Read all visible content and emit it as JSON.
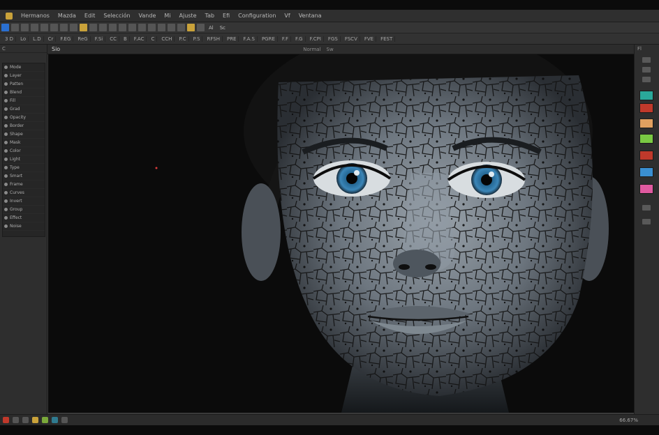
{
  "menubar": {
    "items": [
      "Hermanos",
      "Mazda",
      "Edit",
      "Selección",
      "Vande",
      "Mi",
      "Ajuste",
      "Tab",
      "Efi",
      "Configuration",
      "Vf",
      "Ventana"
    ]
  },
  "toolbar": {
    "labels": [
      "Al",
      "Sc"
    ]
  },
  "optionsbar": {
    "items": [
      "3 D",
      "Lo",
      "L.D",
      "Cr",
      "F.EG",
      "ReG",
      "F.Si",
      "CC",
      "B",
      "F.AC",
      "C",
      "CCH",
      "P.C",
      "P.S",
      "RFSH",
      "PRE",
      "F.A.S",
      "PGRE",
      "F.F",
      "F.G",
      "F.CPI",
      "FGS",
      "FSCV",
      "FVE",
      "FEST"
    ]
  },
  "tabbar": {
    "doc_tab": "Sio",
    "info": "Normal",
    "extra": "Sw"
  },
  "leftpanel": {
    "title": "C",
    "layers": [
      "Mode",
      "Layer",
      "Patten",
      "Blend",
      "Fill",
      "Grad",
      "Opacity",
      "Border",
      "Shape",
      "Mask",
      "Color",
      "Light",
      "Type",
      "Smart",
      "Frame",
      "Curves",
      "Invert",
      "Group",
      "Effect",
      "Noise"
    ]
  },
  "rightpanel": {
    "title": "Fl"
  },
  "colors": {
    "accent": "#2a6fd1",
    "folder": "#c9a23a",
    "swatches": [
      "#2aa89a",
      "#c0392b",
      "#e0a060",
      "#7ac943",
      "#c0392b",
      "#3a8fd1",
      "#e05aa0",
      "#a070d0"
    ]
  },
  "statusbar": {
    "zoom": "66.67%"
  },
  "canvas": {
    "subject": "cracked-porcelain-face",
    "iris_color": "#3b86b8"
  }
}
